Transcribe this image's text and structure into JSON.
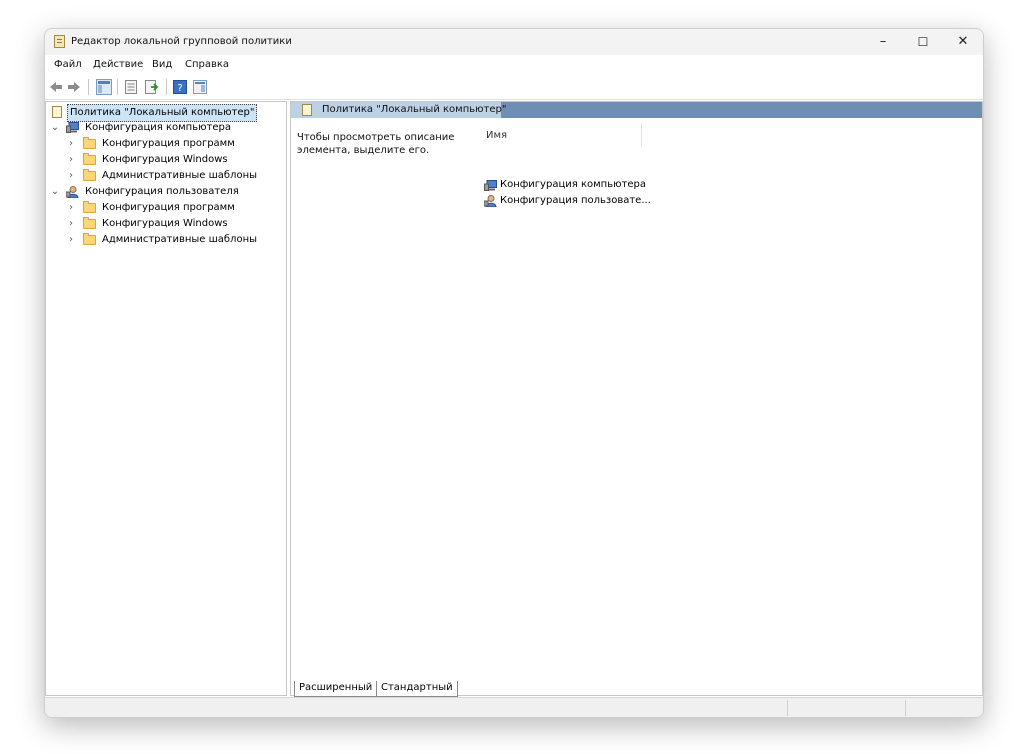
{
  "window": {
    "title": "Редактор локальной групповой политики",
    "controls": {
      "minimize": "–",
      "maximize": "☐",
      "close": "✕"
    }
  },
  "menu": [
    "Файл",
    "Действие",
    "Вид",
    "Справка"
  ],
  "toolbar_icons": [
    "back-arrow-icon",
    "forward-arrow-icon",
    "show-hide-console-tree-icon",
    "properties-icon",
    "export-list-icon",
    "help-icon",
    "show-action-pane-icon"
  ],
  "tree": {
    "root": "Политика \"Локальный компьютер\"",
    "computer": {
      "label": "Конфигурация компьютера",
      "children": [
        "Конфигурация программ",
        "Конфигурация Windows",
        "Административные шаблоны"
      ]
    },
    "user": {
      "label": "Конфигурация пользователя",
      "children": [
        "Конфигурация программ",
        "Конфигурация Windows",
        "Административные шаблоны"
      ]
    }
  },
  "detail": {
    "header": "Политика \"Локальный компьютер\"",
    "description": "Чтобы просмотреть описание элемента, выделите его.",
    "column_name": "Имя",
    "items": [
      "Конфигурация компьютера",
      "Конфигурация пользовате..."
    ]
  },
  "tabs": [
    "Расширенный",
    "Стандартный"
  ],
  "colors": {
    "header_bar": "#6e8fb3",
    "selection": "#cce4f7",
    "folder": "#f5d776"
  }
}
